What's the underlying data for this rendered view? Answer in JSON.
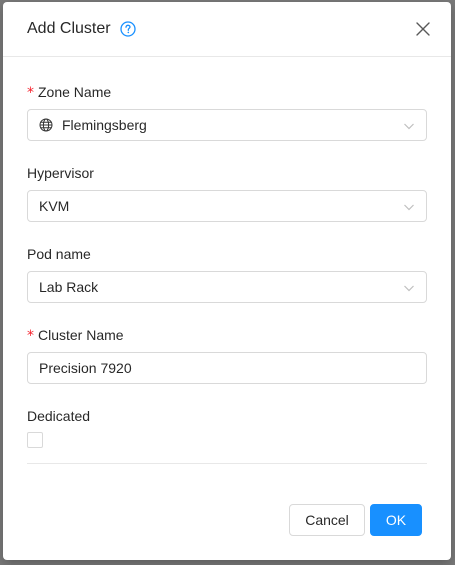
{
  "modal": {
    "title": "Add Cluster",
    "help_icon": "question-circle-icon",
    "close_icon": "close-icon"
  },
  "form": {
    "zone": {
      "required": "*",
      "label": "Zone Name",
      "value": "Flemingsberg",
      "icon": "globe-icon"
    },
    "hypervisor": {
      "label": "Hypervisor",
      "value": "KVM"
    },
    "pod": {
      "label": "Pod name",
      "value": "Lab Rack"
    },
    "cluster": {
      "required": "*",
      "label": "Cluster Name",
      "value": "Precision 7920"
    },
    "dedicated": {
      "label": "Dedicated",
      "checked": false
    }
  },
  "footer": {
    "cancel_label": "Cancel",
    "ok_label": "OK"
  },
  "colors": {
    "primary": "#1890ff",
    "required": "#f5222d",
    "border": "#d9d9d9"
  }
}
